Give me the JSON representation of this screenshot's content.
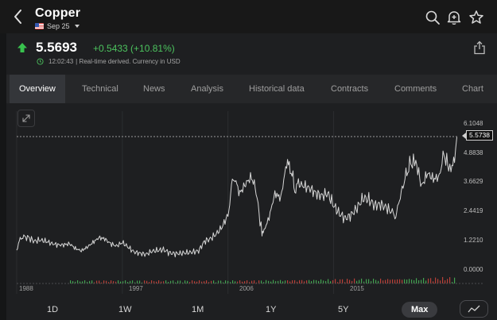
{
  "header": {
    "title": "Copper",
    "expiry": "Sep 25",
    "icons": [
      "back-arrow-icon",
      "search-icon",
      "bell-add-icon",
      "star-icon"
    ]
  },
  "quote": {
    "price": "5.5693",
    "change": "+0.5433 (+10.81%)",
    "time": "12:02:43",
    "note": "| Real-time derived. Currency in USD",
    "direction": "up",
    "up_color": "#4cc35e"
  },
  "tabs": [
    {
      "label": "Overview",
      "active": true
    },
    {
      "label": "Technical"
    },
    {
      "label": "News"
    },
    {
      "label": "Analysis"
    },
    {
      "label": "Historical data"
    },
    {
      "label": "Contracts"
    },
    {
      "label": "Comments"
    },
    {
      "label": "Chart"
    }
  ],
  "ranges": [
    {
      "label": "1D"
    },
    {
      "label": "1W"
    },
    {
      "label": "1M"
    },
    {
      "label": "1Y"
    },
    {
      "label": "5Y"
    },
    {
      "label": "Max",
      "active": true
    }
  ],
  "chart_data": {
    "type": "line",
    "y_tick_labels": [
      "6.1048",
      "4.8838",
      "3.6629",
      "2.4419",
      "1.2210",
      "0.0000"
    ],
    "y_ticks": [
      6.1048,
      4.8838,
      3.6629,
      2.4419,
      1.221,
      0.0
    ],
    "x_tick_labels": [
      "1988",
      "1997",
      "2006",
      "2015"
    ],
    "x_ticks": [
      1988,
      1997,
      2006,
      2015
    ],
    "ylim": [
      0.0,
      6.1048
    ],
    "xlim": [
      1988,
      2025.6
    ],
    "last_price_label": "5.5738",
    "last_price": 5.5738,
    "line_color": "#d6d6d6",
    "volume_colors": [
      "#4cc35e",
      "#e0483e"
    ],
    "series": [
      {
        "x": [
          1988,
          1988.3,
          1988.6,
          1989,
          1989.5,
          1990,
          1990.5,
          1991,
          1991.5,
          1992,
          1992.5,
          1993,
          1993.5,
          1994,
          1994.5,
          1995,
          1995.5,
          1996,
          1996.5,
          1997,
          1997.5,
          1998,
          1998.5,
          1999,
          1999.5,
          2000,
          2000.5,
          2001,
          2001.5,
          2002,
          2002.5,
          2003,
          2003.5,
          2004,
          2004.5,
          2005,
          2005.5,
          2006,
          2006.3,
          2006.6,
          2007,
          2007.5,
          2008,
          2008.4,
          2008.9,
          2009,
          2009.5,
          2010,
          2010.5,
          2011,
          2011.3,
          2011.7,
          2012,
          2012.5,
          2013,
          2013.5,
          2014,
          2014.5,
          2015,
          2015.5,
          2016,
          2016.5,
          2017,
          2017.5,
          2018,
          2018.5,
          2019,
          2019.5,
          2020,
          2020.3,
          2020.6,
          2021,
          2021.4,
          2021.8,
          2022,
          2022.5,
          2023,
          2023.5,
          2024,
          2024.4,
          2024.8,
          2025,
          2025.3,
          2025.5
        ],
        "y": [
          0.9,
          1.25,
          1.4,
          1.35,
          1.2,
          1.25,
          1.2,
          1.1,
          1.05,
          1.05,
          1.1,
          0.9,
          0.8,
          0.95,
          1.15,
          1.35,
          1.3,
          1.1,
          1.0,
          1.15,
          0.95,
          0.75,
          0.7,
          0.65,
          0.78,
          0.82,
          0.85,
          0.72,
          0.68,
          0.7,
          0.72,
          0.75,
          0.8,
          1.2,
          1.3,
          1.5,
          1.8,
          2.3,
          3.5,
          3.8,
          3.2,
          3.6,
          3.9,
          3.3,
          1.45,
          1.55,
          2.2,
          3.2,
          3.0,
          4.5,
          4.3,
          3.4,
          3.6,
          3.5,
          3.4,
          3.2,
          3.1,
          3.2,
          2.7,
          2.35,
          2.15,
          2.3,
          2.6,
          3.0,
          2.95,
          2.7,
          2.75,
          2.6,
          2.4,
          2.3,
          2.9,
          3.7,
          4.3,
          4.6,
          4.55,
          3.5,
          4.05,
          3.8,
          3.9,
          4.9,
          4.2,
          4.3,
          4.4,
          5.55
        ]
      }
    ]
  }
}
